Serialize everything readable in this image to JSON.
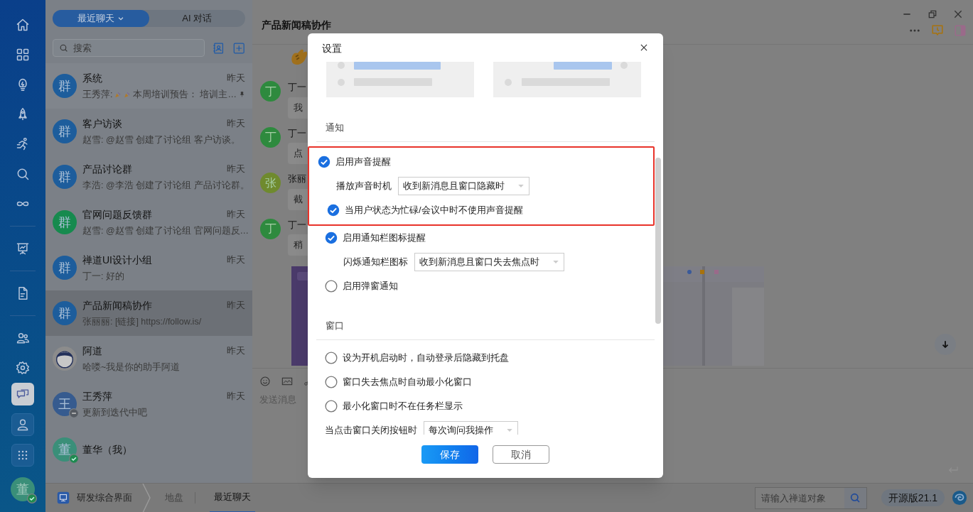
{
  "rail": {
    "items": [
      {
        "selected": false
      },
      {
        "selected": false
      },
      {
        "selected": false
      },
      {
        "selected": false
      },
      {
        "selected": false
      },
      {
        "selected": false
      },
      {
        "selected": false
      },
      {
        "selected": false
      },
      {
        "selected": false
      },
      {
        "selected": false
      },
      {
        "selected": false
      },
      {
        "selected": true
      },
      {
        "selected": false
      },
      {
        "selected": false
      }
    ],
    "user": {
      "avatar": "董",
      "online": true
    }
  },
  "chat_list": {
    "tabs": [
      {
        "label": "最近聊天",
        "selected": true
      },
      {
        "label": "AI 对话",
        "selected": false
      }
    ],
    "search": {
      "placeholder": "搜索"
    },
    "conversations": [
      {
        "name": "系统",
        "time": "昨天",
        "avatar": "群",
        "color": "#1d5d9c",
        "kind": "text",
        "selected": false,
        "pinned": true,
        "preview_parts": [
          {
            "kind": "text",
            "text": "王秀萍:"
          },
          {
            "kind": "party"
          },
          {
            "kind": "party"
          },
          {
            "kind": "text",
            "text": "本周培训预告： 培训主…"
          }
        ]
      },
      {
        "name": "客户访谈",
        "time": "昨天",
        "avatar": "群",
        "color": "#1d5d9c",
        "kind": "text",
        "selected": false,
        "pinned": false,
        "preview": "赵雪: @赵雪 创建了讨论组 客户访谈。"
      },
      {
        "name": "产品讨论群",
        "time": "昨天",
        "avatar": "群",
        "color": "#1d5d9c",
        "kind": "text",
        "selected": false,
        "pinned": false,
        "preview": "李浩: @李浩 创建了讨论组 产品讨论群。"
      },
      {
        "name": "官网问题反馈群",
        "time": "昨天",
        "avatar": "群",
        "color": "#168a4e",
        "kind": "text",
        "selected": false,
        "pinned": false,
        "preview": "赵雪: @赵雪 创建了讨论组 官网问题反…"
      },
      {
        "name": "禅道UI设计小组",
        "time": "昨天",
        "avatar": "群",
        "color": "#1d5d9c",
        "kind": "text",
        "selected": false,
        "pinned": false,
        "preview": "丁一: 好的"
      },
      {
        "name": "产品新闻稿协作",
        "time": "昨天",
        "avatar": "群",
        "color": "#1d5d9c",
        "kind": "text",
        "selected": true,
        "pinned": false,
        "preview": "张丽丽: [链接] https://follow.is/"
      },
      {
        "name": "阿道",
        "time": "昨天",
        "kind": "picture",
        "selected": false,
        "pinned": false,
        "preview": "哈喽~我是你的助手阿道"
      },
      {
        "name": "王秀萍",
        "time": "昨天",
        "avatar": "王",
        "color": "#365b8f",
        "kind": "text",
        "selected": false,
        "pinned": false,
        "busy": true,
        "preview": "更新到迭代中吧"
      },
      {
        "name": "董华（我）",
        "avatar": "董",
        "color": "#3a8f79",
        "kind": "text",
        "selected": false,
        "pinned": false,
        "online": true
      }
    ]
  },
  "chat": {
    "title": "产品新闻稿协作",
    "messages": [
      {
        "avatar": "丁",
        "color": "#2e8a3e",
        "name": "丁一",
        "text": "我"
      },
      {
        "avatar": "丁",
        "color": "#2e8a3e",
        "name": "丁一",
        "text": "点"
      },
      {
        "avatar": "张",
        "color": "#6f8a2e",
        "name": "张丽",
        "text": "截"
      },
      {
        "avatar": "丁",
        "color": "#2e8a3e",
        "name": "丁一",
        "text": "稍"
      }
    ],
    "input": {
      "placeholder": "发送消息"
    }
  },
  "settings": {
    "title": "设置",
    "sections": [
      {
        "title": "通知",
        "groups": [
          {
            "highlighted": true,
            "items": [
              {
                "kind": "check",
                "label": "启用声音提醒",
                "checked": true,
                "children": [
                  {
                    "kind": "select",
                    "label": "播放声音时机",
                    "value": "收到新消息且窗口隐藏时"
                  },
                  {
                    "kind": "check",
                    "label": "当用户状态为忙碌/会议中时不使用声音提醒",
                    "checked": true
                  }
                ]
              }
            ]
          },
          {
            "highlighted": false,
            "items": [
              {
                "kind": "check",
                "label": "启用通知栏图标提醒",
                "checked": true,
                "children": [
                  {
                    "kind": "select",
                    "label": "闪烁通知栏图标",
                    "value": "收到新消息且窗口失去焦点时"
                  }
                ]
              },
              {
                "kind": "check",
                "label": "启用弹窗通知",
                "checked": false
              }
            ]
          }
        ]
      },
      {
        "title": "窗口",
        "groups": [
          {
            "highlighted": false,
            "items": [
              {
                "kind": "check",
                "label": "设为开机启动时，自动登录后隐藏到托盘",
                "checked": false
              },
              {
                "kind": "check",
                "label": "窗口失去焦点时自动最小化窗口",
                "checked": false
              },
              {
                "kind": "check",
                "label": "最小化窗口时不在任务栏显示",
                "checked": false
              },
              {
                "kind": "select",
                "label": "当点击窗口关闭按钮时",
                "value": "每次询问我操作"
              }
            ]
          }
        ]
      }
    ],
    "buttons": [
      {
        "label": "保存",
        "kind": "primary"
      },
      {
        "label": "取消",
        "kind": "secondary"
      }
    ]
  },
  "bottom_bar": {
    "app": "研发综合界面",
    "crumbs": [
      {
        "label": "地盘",
        "selected": false
      },
      {
        "label": "最近聊天",
        "selected": true
      }
    ],
    "search": {
      "placeholder": "请输入禅道对象"
    },
    "version": "开源版21.1"
  }
}
